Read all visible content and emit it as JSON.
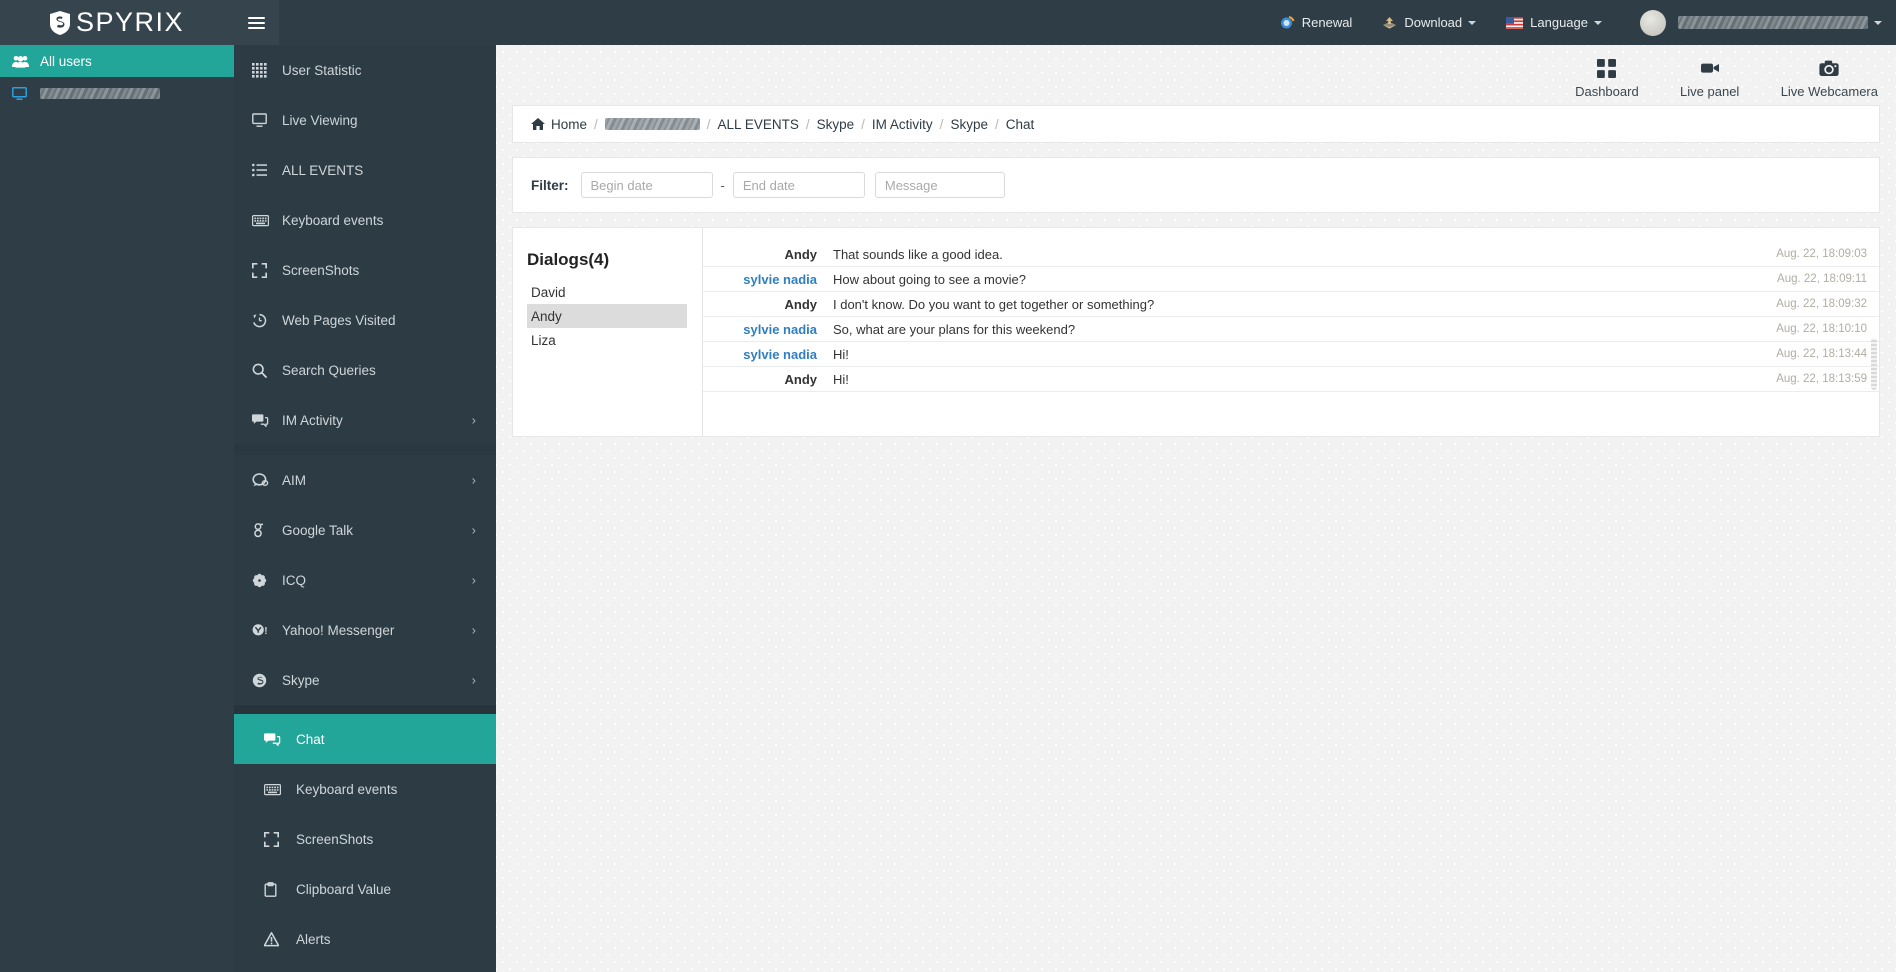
{
  "brand": {
    "name": "SPYRIX",
    "logo_icon": "shield-logo-icon"
  },
  "users_panel": {
    "items": [
      {
        "label": "All users",
        "icon": "users-group-icon",
        "active": true
      },
      {
        "label": "",
        "icon": "monitor-icon",
        "active": false,
        "blurred": true
      }
    ]
  },
  "sidebar": {
    "toggle_icon": "hamburger-icon",
    "items": [
      {
        "label": "User Statistic",
        "icon": "grid-dots-icon",
        "chevron": false,
        "active": false,
        "sub": false
      },
      {
        "label": "Live Viewing",
        "icon": "monitor-icon",
        "chevron": false,
        "active": false,
        "sub": false
      },
      {
        "label": "ALL EVENTS",
        "icon": "list-icon",
        "chevron": false,
        "active": false,
        "sub": false
      },
      {
        "label": "Keyboard events",
        "icon": "keyboard-icon",
        "chevron": false,
        "active": false,
        "sub": false
      },
      {
        "label": "ScreenShots",
        "icon": "crop-frame-icon",
        "chevron": false,
        "active": false,
        "sub": false
      },
      {
        "label": "Web Pages Visited",
        "icon": "history-clock-icon",
        "chevron": false,
        "active": false,
        "sub": false
      },
      {
        "label": "Search Queries",
        "icon": "search-icon",
        "chevron": false,
        "active": false,
        "sub": false
      },
      {
        "label": "IM Activity",
        "icon": "chat-bubbles-icon",
        "chevron": true,
        "active": false,
        "sub": false
      }
    ],
    "im_items": [
      {
        "label": "AIM",
        "icon": "aim-icon",
        "chevron": true,
        "active": false,
        "sub": false
      },
      {
        "label": "Google Talk",
        "icon": "google-talk-icon",
        "chevron": true,
        "active": false,
        "sub": false
      },
      {
        "label": "ICQ",
        "icon": "icq-flower-icon",
        "chevron": true,
        "active": false,
        "sub": false
      },
      {
        "label": "Yahoo! Messenger",
        "icon": "yahoo-icon",
        "chevron": true,
        "active": false,
        "sub": false
      },
      {
        "label": "Skype",
        "icon": "skype-icon",
        "chevron": true,
        "active": false,
        "sub": false
      }
    ],
    "skype_items": [
      {
        "label": "Chat",
        "icon": "chat-bubbles-icon",
        "chevron": false,
        "active": true,
        "sub": true
      },
      {
        "label": "Keyboard events",
        "icon": "keyboard-icon",
        "chevron": false,
        "active": false,
        "sub": true
      },
      {
        "label": "ScreenShots",
        "icon": "crop-frame-icon",
        "chevron": false,
        "active": false,
        "sub": true
      },
      {
        "label": "Clipboard Value",
        "icon": "clipboard-icon",
        "chevron": false,
        "active": false,
        "sub": true
      },
      {
        "label": "Alerts",
        "icon": "warning-icon",
        "chevron": false,
        "active": false,
        "sub": true
      }
    ]
  },
  "topbar": {
    "renewal": "Renewal",
    "download": "Download",
    "language": "Language",
    "account_name": ""
  },
  "quick_actions": [
    {
      "label": "Dashboard",
      "icon": "dashboard-grid-icon"
    },
    {
      "label": "Live panel",
      "icon": "video-camera-icon"
    },
    {
      "label": "Live Webcamera",
      "icon": "photo-camera-icon"
    }
  ],
  "breadcrumb": {
    "home": "Home",
    "items": [
      "",
      "ALL EVENTS",
      "Skype",
      "IM Activity",
      "Skype",
      "Chat"
    ]
  },
  "filter": {
    "label": "Filter:",
    "begin_date_placeholder": "Begin date",
    "begin_date_value": "",
    "separator": "-",
    "end_date_placeholder": "End date",
    "end_date_value": "",
    "message_placeholder": "Message",
    "message_value": ""
  },
  "dialogs": {
    "title": "Dialogs(4)",
    "items": [
      {
        "name": "David",
        "selected": false
      },
      {
        "name": "Andy",
        "selected": true
      },
      {
        "name": "Liza",
        "selected": false
      }
    ]
  },
  "messages": [
    {
      "author": "Andy",
      "is_other": false,
      "text": "That sounds like a good idea.",
      "time": "Aug. 22, 18:09:03"
    },
    {
      "author": "sylvie nadia",
      "is_other": true,
      "text": "How about going to see a movie?",
      "time": "Aug. 22, 18:09:11"
    },
    {
      "author": "Andy",
      "is_other": false,
      "text": "I don't know. Do you want to get together or something?",
      "time": "Aug. 22, 18:09:32"
    },
    {
      "author": "sylvie nadia",
      "is_other": true,
      "text": "So, what are your plans for this weekend?",
      "time": "Aug. 22, 18:10:10"
    },
    {
      "author": "sylvie nadia",
      "is_other": true,
      "text": "Hi!",
      "time": "Aug. 22, 18:13:44"
    },
    {
      "author": "Andy",
      "is_other": false,
      "text": "Hi!",
      "time": "Aug. 22, 18:13:59"
    }
  ],
  "colors": {
    "accent": "#22a699",
    "sidebar_bg": "#2d3b44",
    "topbar_bg": "#2e3d46",
    "link_blue": "#2f7fc1",
    "content_bg": "#f2f2f2"
  }
}
